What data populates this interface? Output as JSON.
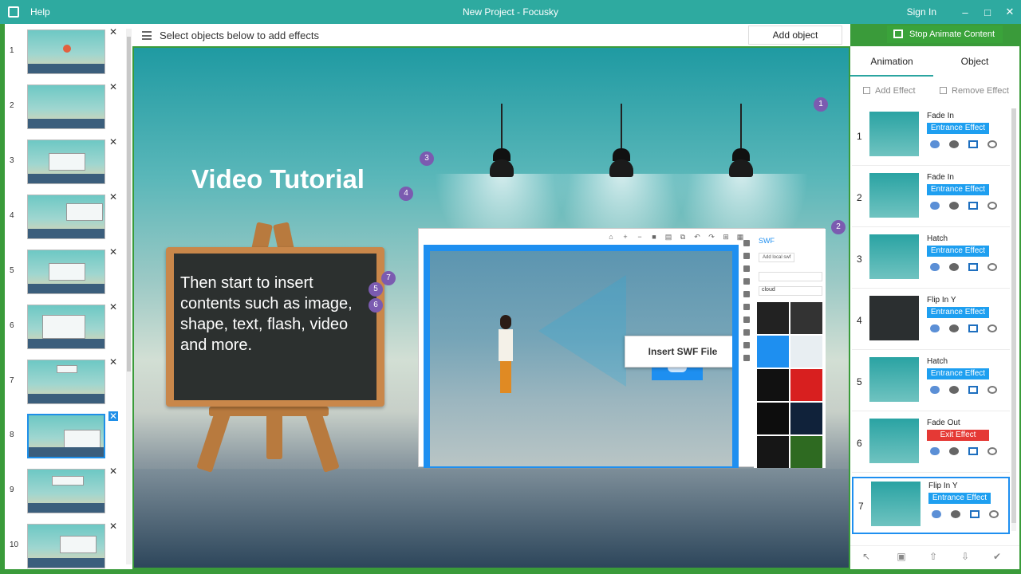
{
  "window": {
    "menu_help": "Help",
    "title": "New Project - Focusky",
    "sign_in": "Sign In",
    "minimize": "–",
    "maximize": "□",
    "close": "✕"
  },
  "toolbar": {
    "hint": "Select objects below to add effects",
    "add_object": "Add object",
    "stop_animate": "Stop Animate Content"
  },
  "slides": {
    "items": [
      {
        "num": "1"
      },
      {
        "num": "2"
      },
      {
        "num": "3"
      },
      {
        "num": "4"
      },
      {
        "num": "5"
      },
      {
        "num": "6"
      },
      {
        "num": "7"
      },
      {
        "num": "8"
      },
      {
        "num": "9"
      },
      {
        "num": "10"
      }
    ],
    "close_glyph": "✕"
  },
  "canvas": {
    "title": "Video Tutorial",
    "board_text": "Then start to insert contents such as image, shape, text, flash, video and more.",
    "callout": "Insert SWF File",
    "badges": [
      "1",
      "2",
      "3",
      "4",
      "5",
      "6",
      "7"
    ],
    "swf_panel": {
      "title": "SWF",
      "add_local": "Add local swf",
      "category": "cloud"
    },
    "toolbar_glyphs": [
      "⌂",
      "+",
      "−",
      "■",
      "▤",
      "⧉",
      "↶",
      "↷",
      "⊞",
      "▦"
    ]
  },
  "right_panel": {
    "tabs": [
      "Animation",
      "Object"
    ],
    "add_effect": "Add Effect",
    "remove_effect": "Remove Effect",
    "effects": [
      {
        "num": "1",
        "name": "Fade In",
        "tag": "Entrance Effect"
      },
      {
        "num": "2",
        "name": "Fade In",
        "tag": "Entrance Effect"
      },
      {
        "num": "3",
        "name": "Hatch",
        "tag": "Entrance Effect"
      },
      {
        "num": "4",
        "name": "Flip In Y",
        "tag": "Entrance Effect"
      },
      {
        "num": "5",
        "name": "Hatch",
        "tag": "Entrance Effect"
      },
      {
        "num": "6",
        "name": "Fade Out",
        "tag": "Exit Effect"
      },
      {
        "num": "7",
        "name": "Flip In Y",
        "tag": "Entrance Effect"
      }
    ],
    "bottom_glyphs": [
      "↖",
      "▣",
      "⇧",
      "⇩",
      "✔"
    ]
  },
  "colors": {
    "teal": "#2eaaa0",
    "green_button": "#3aa33a",
    "entrance_tag": "#1e9ff0",
    "exit_tag": "#e53935",
    "selected_border": "#1e8ff0",
    "badge": "#7b5bb0"
  }
}
